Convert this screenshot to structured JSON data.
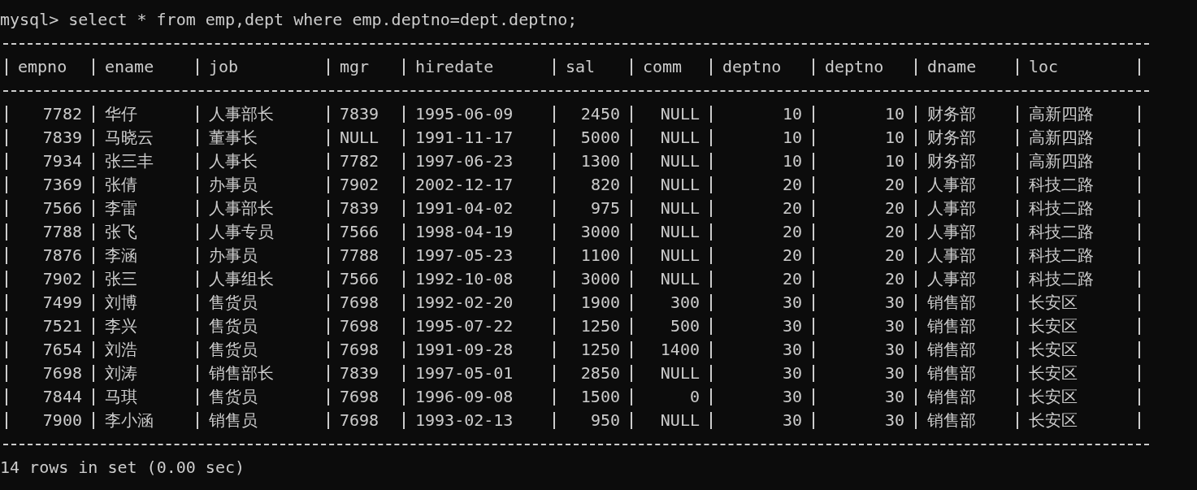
{
  "terminal": {
    "prompt": "mysql>",
    "command": "select * from emp,dept where emp.deptno=dept.deptno;",
    "table": {
      "columns": [
        {
          "label": "empno",
          "numeric": true
        },
        {
          "label": "ename",
          "numeric": false
        },
        {
          "label": "job",
          "numeric": false
        },
        {
          "label": "mgr",
          "numeric": false
        },
        {
          "label": "hiredate",
          "numeric": false
        },
        {
          "label": "sal",
          "numeric": true
        },
        {
          "label": "comm",
          "numeric": true
        },
        {
          "label": "deptno",
          "numeric": true
        },
        {
          "label": "deptno",
          "numeric": true
        },
        {
          "label": "dname",
          "numeric": false
        },
        {
          "label": "loc",
          "numeric": false
        }
      ],
      "rows": [
        [
          "7782",
          "华仔",
          "人事部长",
          "7839",
          "1995-06-09",
          "2450",
          "NULL",
          "10",
          "10",
          "财务部",
          "高新四路"
        ],
        [
          "7839",
          "马晓云",
          "董事长",
          "NULL",
          "1991-11-17",
          "5000",
          "NULL",
          "10",
          "10",
          "财务部",
          "高新四路"
        ],
        [
          "7934",
          "张三丰",
          "人事长",
          "7782",
          "1997-06-23",
          "1300",
          "NULL",
          "10",
          "10",
          "财务部",
          "高新四路"
        ],
        [
          "7369",
          "张倩",
          "办事员",
          "7902",
          "2002-12-17",
          "820",
          "NULL",
          "20",
          "20",
          "人事部",
          "科技二路"
        ],
        [
          "7566",
          "李雷",
          "人事部长",
          "7839",
          "1991-04-02",
          "975",
          "NULL",
          "20",
          "20",
          "人事部",
          "科技二路"
        ],
        [
          "7788",
          "张飞",
          "人事专员",
          "7566",
          "1998-04-19",
          "3000",
          "NULL",
          "20",
          "20",
          "人事部",
          "科技二路"
        ],
        [
          "7876",
          "李涵",
          "办事员",
          "7788",
          "1997-05-23",
          "1100",
          "NULL",
          "20",
          "20",
          "人事部",
          "科技二路"
        ],
        [
          "7902",
          "张三",
          "人事组长",
          "7566",
          "1992-10-08",
          "3000",
          "NULL",
          "20",
          "20",
          "人事部",
          "科技二路"
        ],
        [
          "7499",
          "刘博",
          "售货员",
          "7698",
          "1992-02-20",
          "1900",
          "300",
          "30",
          "30",
          "销售部",
          "长安区"
        ],
        [
          "7521",
          "李兴",
          "售货员",
          "7698",
          "1995-07-22",
          "1250",
          "500",
          "30",
          "30",
          "销售部",
          "长安区"
        ],
        [
          "7654",
          "刘浩",
          "售货员",
          "7698",
          "1991-09-28",
          "1250",
          "1400",
          "30",
          "30",
          "销售部",
          "长安区"
        ],
        [
          "7698",
          "刘涛",
          "销售部长",
          "7839",
          "1997-05-01",
          "2850",
          "NULL",
          "30",
          "30",
          "销售部",
          "长安区"
        ],
        [
          "7844",
          "马琪",
          "售货员",
          "7698",
          "1996-09-08",
          "1500",
          "0",
          "30",
          "30",
          "销售部",
          "长安区"
        ],
        [
          "7900",
          "李小涵",
          "销售员",
          "7698",
          "1993-02-13",
          "950",
          "NULL",
          "30",
          "30",
          "销售部",
          "长安区"
        ]
      ]
    },
    "status": "14 rows in set (0.00 sec)"
  }
}
